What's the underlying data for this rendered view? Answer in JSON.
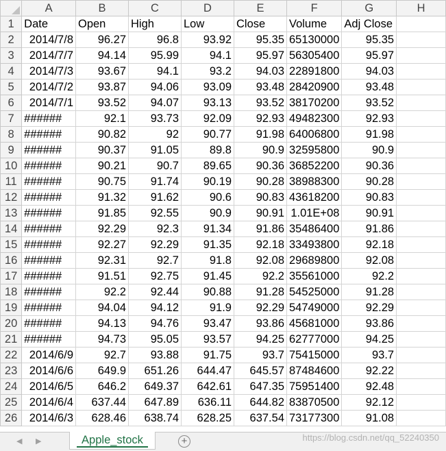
{
  "sheet": {
    "column_letters": [
      "A",
      "B",
      "C",
      "D",
      "E",
      "F",
      "G",
      "H"
    ],
    "rows": [
      {
        "n": "1",
        "c": [
          "Date",
          "Open",
          "High",
          "Low",
          "Close",
          "Volume",
          "Adj Close",
          ""
        ]
      },
      {
        "n": "2",
        "c": [
          "2014/7/8",
          "96.27",
          "96.8",
          "93.92",
          "95.35",
          "65130000",
          "95.35",
          ""
        ]
      },
      {
        "n": "3",
        "c": [
          "2014/7/7",
          "94.14",
          "95.99",
          "94.1",
          "95.97",
          "56305400",
          "95.97",
          ""
        ]
      },
      {
        "n": "4",
        "c": [
          "2014/7/3",
          "93.67",
          "94.1",
          "93.2",
          "94.03",
          "22891800",
          "94.03",
          ""
        ]
      },
      {
        "n": "5",
        "c": [
          "2014/7/2",
          "93.87",
          "94.06",
          "93.09",
          "93.48",
          "28420900",
          "93.48",
          ""
        ]
      },
      {
        "n": "6",
        "c": [
          "2014/7/1",
          "93.52",
          "94.07",
          "93.13",
          "93.52",
          "38170200",
          "93.52",
          ""
        ]
      },
      {
        "n": "7",
        "c": [
          "######",
          "92.1",
          "93.73",
          "92.09",
          "92.93",
          "49482300",
          "92.93",
          ""
        ]
      },
      {
        "n": "8",
        "c": [
          "######",
          "90.82",
          "92",
          "90.77",
          "91.98",
          "64006800",
          "91.98",
          ""
        ]
      },
      {
        "n": "9",
        "c": [
          "######",
          "90.37",
          "91.05",
          "89.8",
          "90.9",
          "32595800",
          "90.9",
          ""
        ]
      },
      {
        "n": "10",
        "c": [
          "######",
          "90.21",
          "90.7",
          "89.65",
          "90.36",
          "36852200",
          "90.36",
          ""
        ]
      },
      {
        "n": "11",
        "c": [
          "######",
          "90.75",
          "91.74",
          "90.19",
          "90.28",
          "38988300",
          "90.28",
          ""
        ]
      },
      {
        "n": "12",
        "c": [
          "######",
          "91.32",
          "91.62",
          "90.6",
          "90.83",
          "43618200",
          "90.83",
          ""
        ]
      },
      {
        "n": "13",
        "c": [
          "######",
          "91.85",
          "92.55",
          "90.9",
          "90.91",
          "1.01E+08",
          "90.91",
          ""
        ]
      },
      {
        "n": "14",
        "c": [
          "######",
          "92.29",
          "92.3",
          "91.34",
          "91.86",
          "35486400",
          "91.86",
          ""
        ]
      },
      {
        "n": "15",
        "c": [
          "######",
          "92.27",
          "92.29",
          "91.35",
          "92.18",
          "33493800",
          "92.18",
          ""
        ]
      },
      {
        "n": "16",
        "c": [
          "######",
          "92.31",
          "92.7",
          "91.8",
          "92.08",
          "29689800",
          "92.08",
          ""
        ]
      },
      {
        "n": "17",
        "c": [
          "######",
          "91.51",
          "92.75",
          "91.45",
          "92.2",
          "35561000",
          "92.2",
          ""
        ]
      },
      {
        "n": "18",
        "c": [
          "######",
          "92.2",
          "92.44",
          "90.88",
          "91.28",
          "54525000",
          "91.28",
          ""
        ]
      },
      {
        "n": "19",
        "c": [
          "######",
          "94.04",
          "94.12",
          "91.9",
          "92.29",
          "54749000",
          "92.29",
          ""
        ]
      },
      {
        "n": "20",
        "c": [
          "######",
          "94.13",
          "94.76",
          "93.47",
          "93.86",
          "45681000",
          "93.86",
          ""
        ]
      },
      {
        "n": "21",
        "c": [
          "######",
          "94.73",
          "95.05",
          "93.57",
          "94.25",
          "62777000",
          "94.25",
          ""
        ]
      },
      {
        "n": "22",
        "c": [
          "2014/6/9",
          "92.7",
          "93.88",
          "91.75",
          "93.7",
          "75415000",
          "93.7",
          ""
        ]
      },
      {
        "n": "23",
        "c": [
          "2014/6/6",
          "649.9",
          "651.26",
          "644.47",
          "645.57",
          "87484600",
          "92.22",
          ""
        ]
      },
      {
        "n": "24",
        "c": [
          "2014/6/5",
          "646.2",
          "649.37",
          "642.61",
          "647.35",
          "75951400",
          "92.48",
          ""
        ]
      },
      {
        "n": "25",
        "c": [
          "2014/6/4",
          "637.44",
          "647.89",
          "636.11",
          "644.82",
          "83870500",
          "92.12",
          ""
        ]
      },
      {
        "n": "26",
        "c": [
          "2014/6/3",
          "628.46",
          "638.74",
          "628.25",
          "637.54",
          "73177300",
          "91.08",
          ""
        ]
      }
    ]
  },
  "tabs": {
    "prev_icon": "◀",
    "next_icon": "▶",
    "sheet_name": "Apple_stock",
    "add_icon": "+"
  },
  "watermark": "https://blog.csdn.net/qq_52240350"
}
